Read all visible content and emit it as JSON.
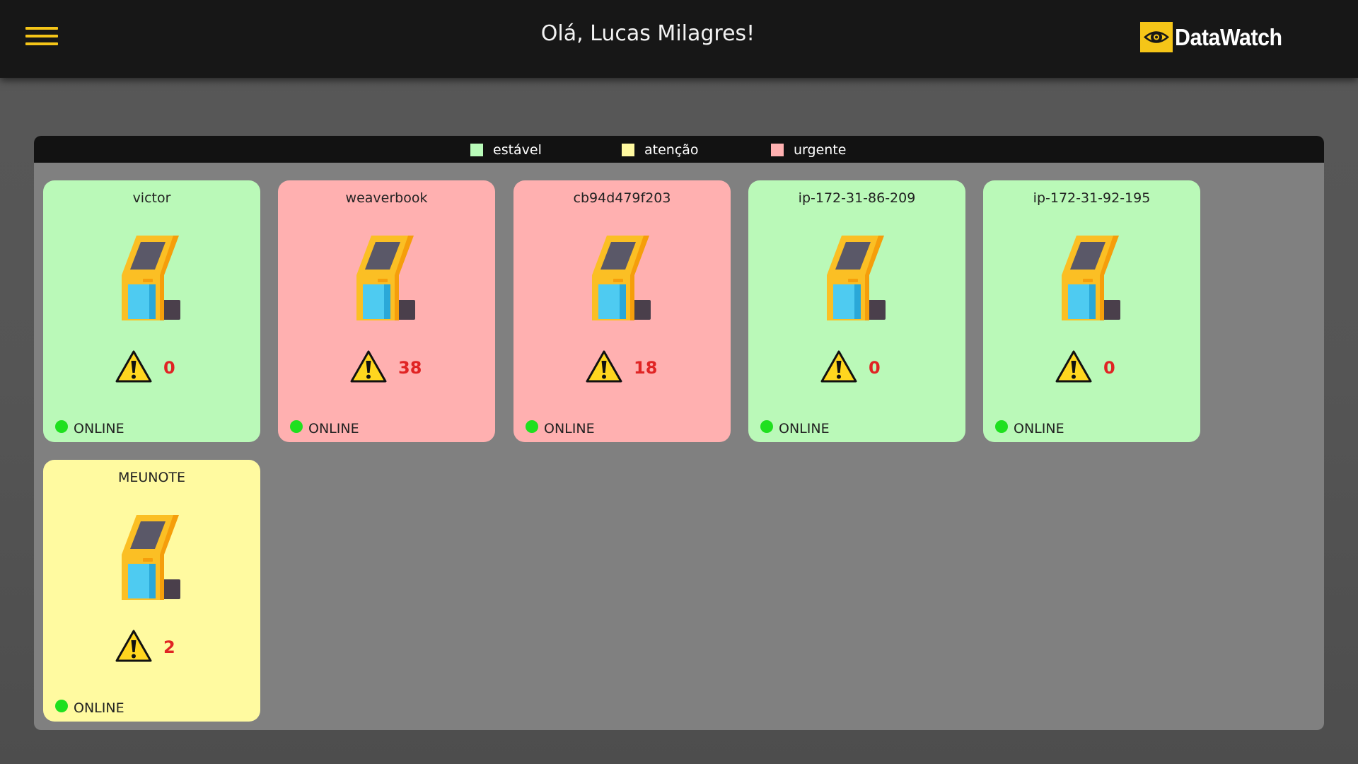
{
  "header": {
    "greeting": "Olá, Lucas Milagres!",
    "brand_name": "DataWatch",
    "menu_icon": "hamburger-menu-icon",
    "brand_icon": "eye-icon"
  },
  "legend": [
    {
      "label": "estável",
      "color": "#b9fbb9"
    },
    {
      "label": "atenção",
      "color": "#fff9a0"
    },
    {
      "label": "urgente",
      "color": "#ffb1b1"
    }
  ],
  "colors": {
    "stable": "#baf9b8",
    "attention": "#fffaa0",
    "urgent": "#ffb0b0",
    "accent": "#f5c518",
    "alert_count": "#e02424",
    "online_dot": "#1fe01f"
  },
  "machines": [
    {
      "name": "victor",
      "alerts": "0",
      "status": "ONLINE",
      "state": "stable",
      "icon": "kiosk-icon"
    },
    {
      "name": "weaverbook",
      "alerts": "38",
      "status": "ONLINE",
      "state": "urgent",
      "icon": "kiosk-icon"
    },
    {
      "name": "cb94d479f203",
      "alerts": "18",
      "status": "ONLINE",
      "state": "urgent",
      "icon": "kiosk-icon"
    },
    {
      "name": "ip-172-31-86-209",
      "alerts": "0",
      "status": "ONLINE",
      "state": "stable",
      "icon": "kiosk-icon"
    },
    {
      "name": "ip-172-31-92-195",
      "alerts": "0",
      "status": "ONLINE",
      "state": "stable",
      "icon": "kiosk-icon"
    },
    {
      "name": "MEUNOTE",
      "alerts": "2",
      "status": "ONLINE",
      "state": "attention",
      "icon": "kiosk-icon"
    }
  ]
}
